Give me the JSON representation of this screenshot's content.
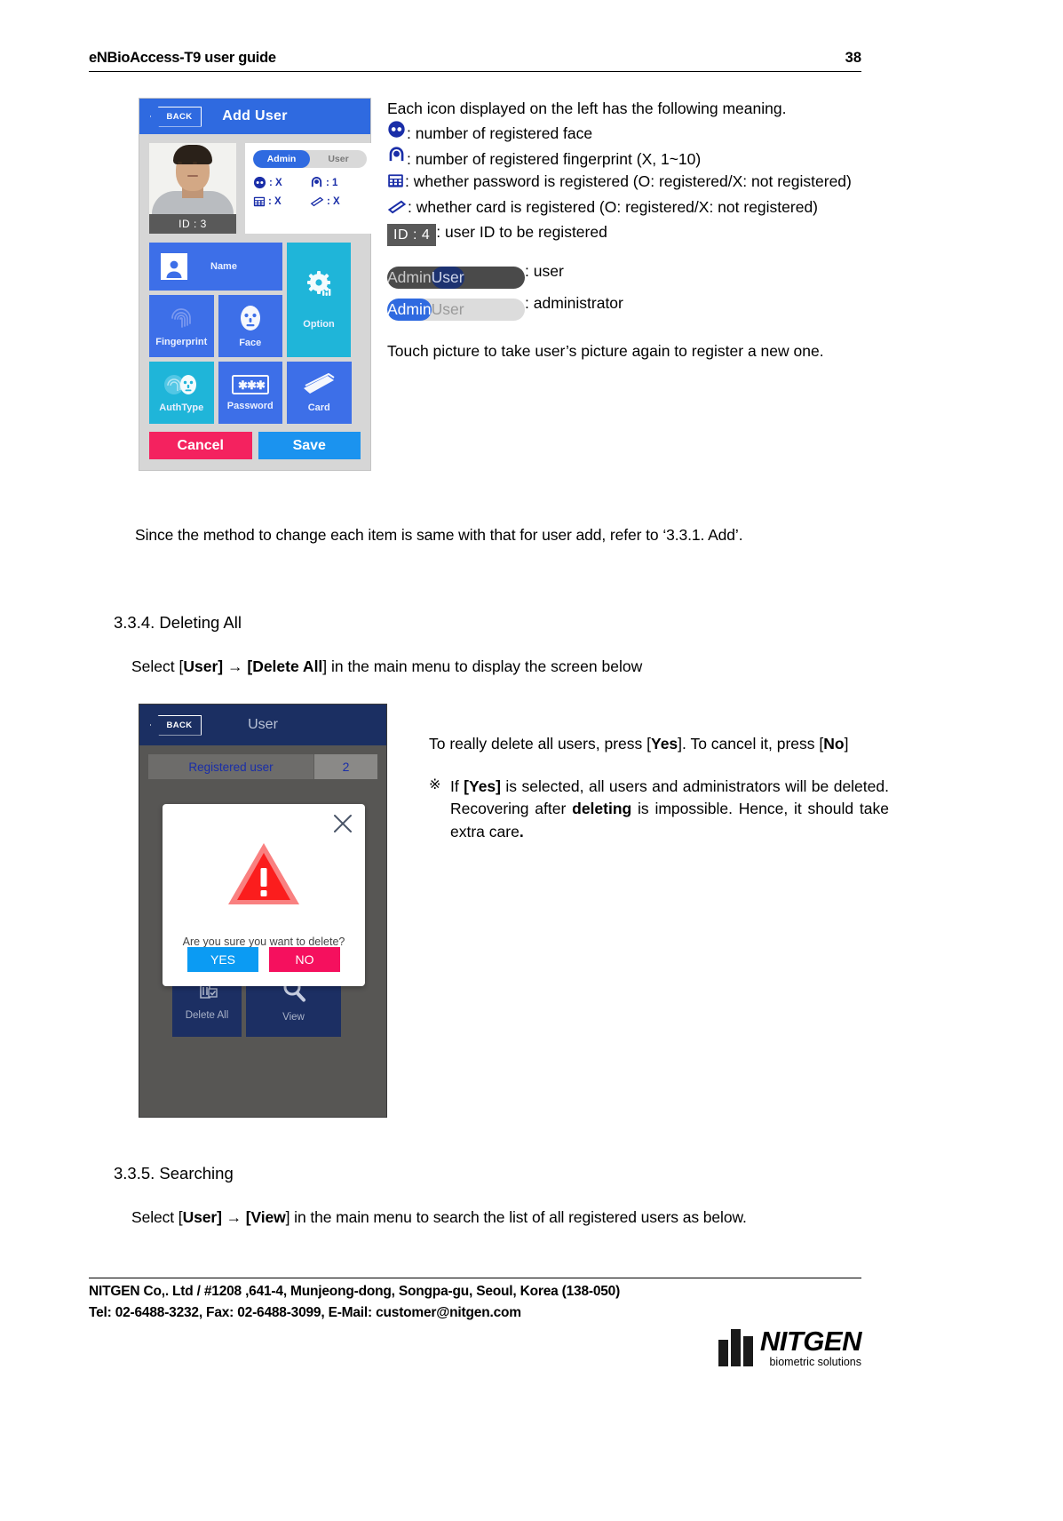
{
  "header": {
    "title": "eNBioAccess-T9 user guide",
    "page": "38"
  },
  "add_user_screen": {
    "back_label": "BACK",
    "title": "Add User",
    "id_label": "ID : 3",
    "segment": {
      "admin": "Admin",
      "user": "User",
      "selected": "Admin"
    },
    "stats": [
      {
        "icon": "face-icon",
        "value": ": X"
      },
      {
        "icon": "fingerprint-icon",
        "value": ": 1"
      },
      {
        "icon": "password-keypad-icon",
        "value": ": X"
      },
      {
        "icon": "card-icon",
        "value": ": X"
      }
    ],
    "tiles": [
      {
        "label": "Name",
        "icon": "portrait-icon"
      },
      {
        "label": "Option",
        "icon": "gear-icon"
      },
      {
        "label": "Fingerprint",
        "icon": "fingerprint-icon"
      },
      {
        "label": "Face",
        "icon": "face-icon"
      },
      {
        "label": "AuthType",
        "icon": "authtype-icon"
      },
      {
        "label": "Password",
        "icon": "asterisks-icon"
      },
      {
        "label": "Card",
        "icon": "card-icon"
      }
    ],
    "cancel_label": "Cancel",
    "save_label": "Save"
  },
  "legend": {
    "intro": "Each icon displayed on the left has the following meaning.",
    "face": ": number of registered face",
    "fingerprint": ": number of registered fingerprint (X, 1~10)",
    "password": ": whether password is registered (O: registered/X: not registered)",
    "card": ": whether card is registered (O: registered/X: not registered)",
    "id_badge": "ID : 4",
    "id_desc": ": user ID to be registered",
    "seg_admin_label": "Admin",
    "seg_user_label": "User",
    "seg_user_desc": ": user",
    "seg_admin_desc": ": administrator",
    "touch_note": "Touch picture to take user’s picture again to register a new one."
  },
  "since_paragraph": "Since the method to change each item is same with that for user add, refer to ‘3.3.1. Add’.",
  "section_334": {
    "heading": "3.3.4. Deleting All",
    "select_prefix": "Select [",
    "select_bold1": "User",
    "select_arrow": "] → [",
    "select_bold2": "Delete All",
    "select_suffix": "] in the main menu to display the screen below"
  },
  "delete_screen": {
    "back_label": "BACK",
    "title": "User",
    "registered_label": "Registered user",
    "registered_count": "2",
    "dialog": {
      "message": "Are you sure you want to delete?",
      "yes_label": "YES",
      "no_label": "NO",
      "close_icon": "close-icon",
      "warning_icon": "warning-triangle-icon"
    },
    "bottom_tiles": [
      {
        "label": "Delete All",
        "icon": "trash-icon"
      },
      {
        "label": "View",
        "icon": "magnifier-icon"
      }
    ]
  },
  "delete_text": {
    "line1_a": "To really delete all users, press [",
    "line1_b": "Yes",
    "line1_c": "]. To cancel it, press [",
    "line1_d": "No",
    "line1_e": "]",
    "note_mark": "※",
    "note_a": "If ",
    "note_b": "[Yes]",
    "note_c": " is selected, all users and administrators will be deleted. Recovering after ",
    "note_d": "deleting",
    "note_e": " is impossible. Hence, it should take extra care",
    "note_f": "."
  },
  "section_335": {
    "heading": "3.3.5. Searching",
    "select_prefix": "Select [",
    "select_bold1": "User",
    "select_arrow": "] → [",
    "select_bold2": "View",
    "select_suffix": "] in the main menu to search the list of all registered users as below."
  },
  "footer": {
    "line1": "NITGEN Co,. Ltd / #1208 ,641-4, Munjeong-dong, Songpa-gu, Seoul, Korea (138-050)",
    "line2": "Tel: 02-6488-3232, Fax: 02-6488-3099, E-Mail: customer@nitgen.com",
    "logo_name": "NITGEN",
    "logo_sub": "biometric solutions"
  },
  "colors": {
    "header_blue": "#2f6ae0",
    "tile_blue": "#3d6fe8",
    "tile_cyan": "#1fb5d9",
    "cancel_pink": "#f4225f",
    "save_blue": "#1b93ef",
    "dialog_yes": "#0b9bf3",
    "dialog_no": "#f5105e",
    "warn_red": "#fb1d1d",
    "navy": "#1b2f62"
  }
}
